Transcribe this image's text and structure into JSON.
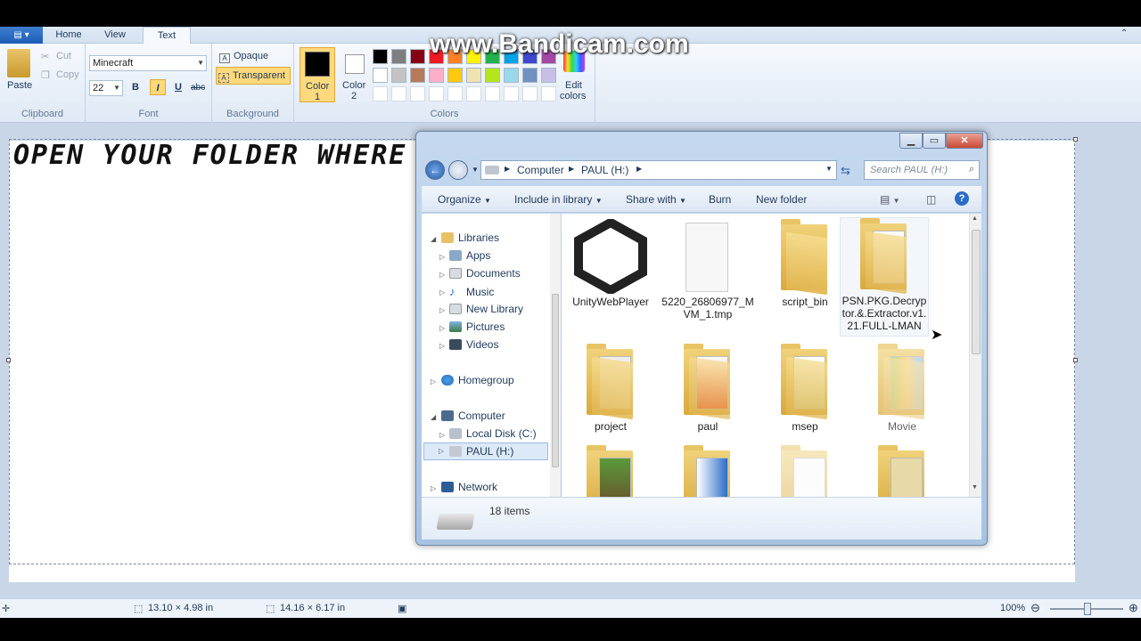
{
  "watermark": "www.Bandicam.com",
  "ribbon": {
    "tabs": [
      {
        "label": "Home"
      },
      {
        "label": "View"
      },
      {
        "label": "Text"
      }
    ],
    "clipboard": {
      "paste": "Paste",
      "cut": "Cut",
      "copy": "Copy",
      "group": "Clipboard"
    },
    "font": {
      "family": "Minecraft",
      "size": "22",
      "bold": "B",
      "italic": "I",
      "underline": "U",
      "strike": "abc",
      "group": "Font"
    },
    "background": {
      "opaque": "Opaque",
      "transparent": "Transparent",
      "group": "Background"
    },
    "colors": {
      "color1_line1": "Color",
      "color1_line2": "1",
      "color2_line1": "Color",
      "color2_line2": "2",
      "edit_line1": "Edit",
      "edit_line2": "colors",
      "group": "Colors",
      "color1": "#000000",
      "color2": "#ffffff",
      "palette_row1": [
        "#000000",
        "#7f7f7f",
        "#880015",
        "#ed1c24",
        "#ff7f27",
        "#fff200",
        "#22b14c",
        "#00a2e8",
        "#3f48cc",
        "#a349a4"
      ],
      "palette_row2": [
        "#ffffff",
        "#c3c3c3",
        "#b97a57",
        "#ffaec9",
        "#ffc90e",
        "#efe4b0",
        "#b5e61d",
        "#99d9ea",
        "#7092be",
        "#c8bfe7"
      ]
    }
  },
  "canvas": {
    "text": "OPEN YOUR FOLDER WHERE U SAVED IT"
  },
  "explorer": {
    "address": [
      "Computer",
      "PAUL (H:)"
    ],
    "search_placeholder": "Search PAUL (H:)",
    "toolbar": {
      "organize": "Organize",
      "include": "Include in library",
      "share": "Share with",
      "burn": "Burn",
      "new_folder": "New folder"
    },
    "nav": {
      "libraries": "Libraries",
      "apps": "Apps",
      "documents": "Documents",
      "music": "Music",
      "new_library": "New Library",
      "pictures": "Pictures",
      "videos": "Videos",
      "homegroup": "Homegroup",
      "computer": "Computer",
      "local_disk": "Local Disk (C:)",
      "paul": "PAUL (H:)",
      "network": "Network"
    },
    "files": [
      {
        "name": "UnityWebPlayer",
        "kind": "unity-icon"
      },
      {
        "name": "5220_26806977_MVM_1.tmp",
        "kind": "blank-file-icon"
      },
      {
        "name": "script_bin",
        "kind": "folder-icon"
      },
      {
        "name": "PSN.PKG.Decryptor.&.Extractor.v1.21.FULL-LMAN",
        "kind": "folder-icon"
      },
      {
        "name": "project",
        "kind": "folder-icon"
      },
      {
        "name": "paul",
        "kind": "folder-icon"
      },
      {
        "name": "msep",
        "kind": "folder-icon"
      },
      {
        "name": "Movie",
        "kind": "folder-icon"
      }
    ],
    "item_count": "18 items"
  },
  "status": {
    "selection_size": "13.10 × 4.98 in",
    "image_size": "14.16 × 6.17 in",
    "zoom": "100%"
  }
}
